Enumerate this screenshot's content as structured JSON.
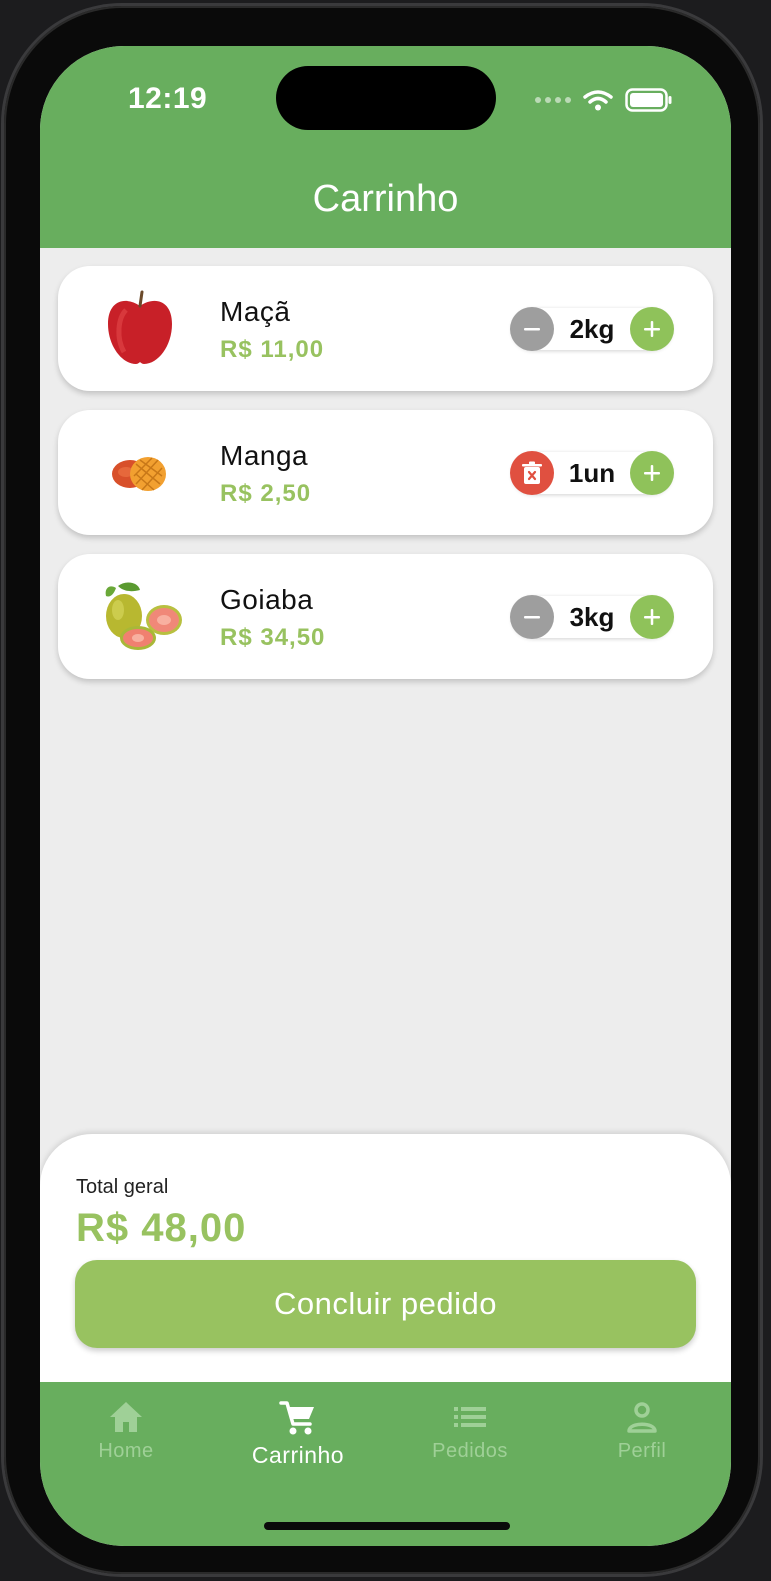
{
  "status_bar": {
    "time": "12:19"
  },
  "header": {
    "title": "Carrinho"
  },
  "cart": {
    "items": [
      {
        "name": "Maçã",
        "price": "R$ 11,00",
        "quantity": "2kg",
        "image_icon": "apple-image"
      },
      {
        "name": "Manga",
        "price": "R$ 2,50",
        "quantity": "1un",
        "image_icon": "mango-image"
      },
      {
        "name": "Goiaba",
        "price": "R$ 34,50",
        "quantity": "3kg",
        "image_icon": "guava-image"
      }
    ]
  },
  "summary": {
    "total_label": "Total geral",
    "total_value": "R$ 48,00",
    "checkout_label": "Concluir pedido"
  },
  "tabbar": {
    "tabs": [
      {
        "label": "Home",
        "icon": "home-icon",
        "active": false
      },
      {
        "label": "Carrinho",
        "icon": "cart-icon",
        "active": true
      },
      {
        "label": "Pedidos",
        "icon": "list-icon",
        "active": false
      },
      {
        "label": "Perfil",
        "icon": "person-icon",
        "active": false
      }
    ]
  },
  "colors": {
    "primary_green": "#68ae5e",
    "accent_green": "#98c260",
    "delete_red": "#e05040",
    "minus_gray": "#9e9e9e",
    "background": "#ededed"
  }
}
